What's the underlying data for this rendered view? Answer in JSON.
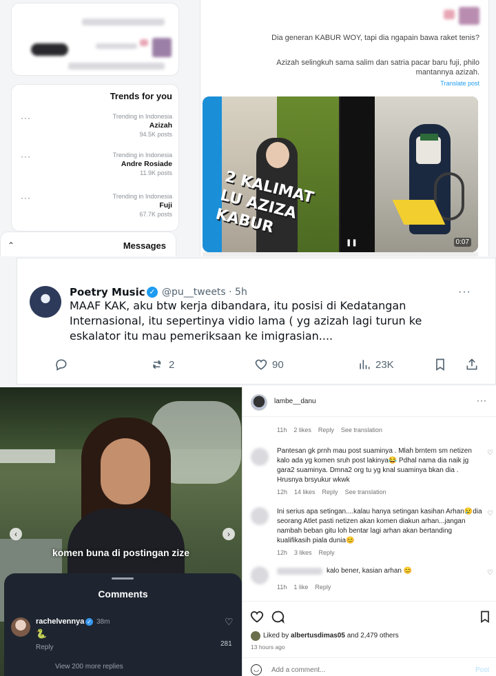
{
  "x_web": {
    "tweet_text_1": "Dia generan KABUR WOY, tapi dia ngapain bawa raket tenis?",
    "tweet_text_2": "Azizah selingkuh sama salim dan satria pacar baru fuji,  philo mantannya azizah.",
    "translate": "Translate post",
    "trends_heading": "Trends for you",
    "trends": [
      {
        "meta": "Trending in Indonesia",
        "name": "Azizah",
        "posts": "94.5K posts"
      },
      {
        "meta": "Trending in Indonesia",
        "name": "Andre Rosiade",
        "posts": "11.9K posts"
      },
      {
        "meta": "Trending in Indonesia",
        "name": "Fuji",
        "posts": "67.7K posts"
      }
    ],
    "more": "···",
    "messages": "Messages",
    "video_overlay": "2 KALIMAT LU AZIZA KABUR",
    "video_time": "0:07"
  },
  "tweet": {
    "name": "Poetry Music",
    "handle": "@pu__tweets · 5h",
    "text": "MAAF KAK, aku btw kerja dibandara, itu posisi di Kedatangan Internasional, itu sepertinya vidio lama ( yg azizah lagi turun ke eskalator itu mau pemeriksaan ke imigrasian....",
    "replies": "",
    "retweets": "2",
    "likes": "90",
    "views": "23K",
    "more": "···"
  },
  "story": {
    "caption": "komen buna di postingan zize",
    "comments_title": "Comments",
    "commenter": "rachelvennya",
    "comment_time": "38m",
    "comment_emoji": "🐍",
    "reply": "Reply",
    "like_count": "281",
    "view_more": "View 200 more replies"
  },
  "instagram": {
    "username": "lambe__danu",
    "top_meta": {
      "time": "11h",
      "likes": "2 likes",
      "reply": "Reply",
      "translate": "See translation"
    },
    "comments": [
      {
        "text": "Pantesan gk prnh mau post suaminya . Mlah brntem sm netizen kalo ada yg komen sruh post lakinya😂 Pdhal nama dia naik jg gara2 suaminya. Dmna2 org tu yg knal suaminya bkan dia . Hrusnya brsyukur wkwk",
        "time": "12h",
        "likes": "14 likes",
        "reply": "Reply",
        "translate": "See translation"
      },
      {
        "text": "Ini serius apa setingan....kalau hanya setingan kasihan Arhan😢dia seorang Atlet pasti netizen akan komen diakun arhan...jangan nambah beban gitu loh bentar lagi arhan akan bertanding kualifikasih piala dunia😊",
        "time": "12h",
        "likes": "3 likes",
        "reply": "Reply",
        "translate": ""
      },
      {
        "text": "kalo bener, kasian arhan 😊",
        "time": "11h",
        "likes": "1 like",
        "reply": "Reply",
        "translate": ""
      }
    ],
    "liked_by_prefix": "Liked by ",
    "liked_by_user": "albertusdimas05",
    "liked_by_suffix": " and 2,479 others",
    "post_time": "13 hours ago",
    "add_comment": "Add a comment...",
    "post_button": "Post"
  },
  "colors": {
    "x_blue": "#1d9bf0",
    "ig_link": "#00376b",
    "sheet_bg": "#1e2530"
  }
}
